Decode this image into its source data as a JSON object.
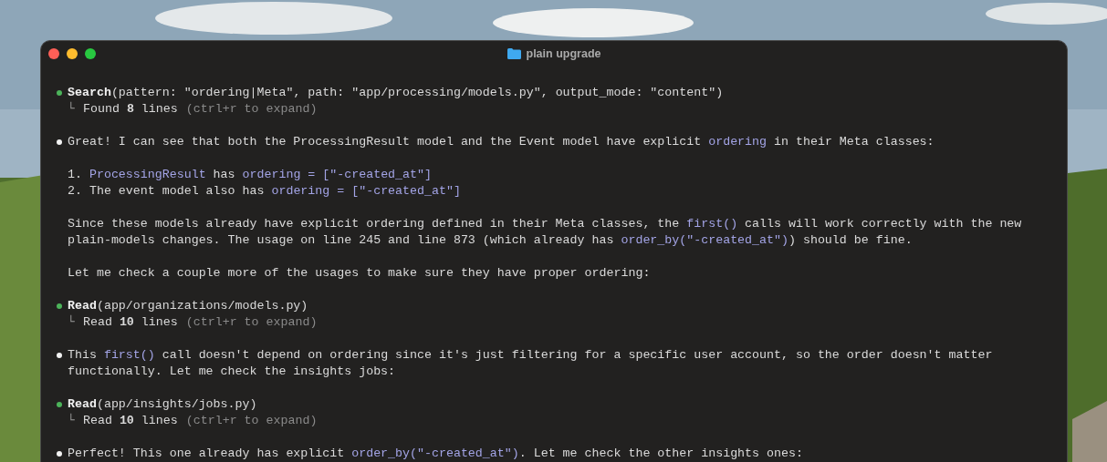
{
  "window": {
    "title": "plain upgrade"
  },
  "transcript": [
    {
      "kind": "tool",
      "name": "Search",
      "args": "(pattern: \"ordering|Meta\", path: \"app/processing/models.py\", output_mode: \"content\")",
      "connector": "└",
      "result": "Found **8** lines",
      "hint": "(ctrl+r to expand)"
    },
    {
      "kind": "message",
      "paragraphs": [
        {
          "kind": "text",
          "segments": [
            {
              "text": "Great! I can see that both the ProcessingResult model and the Event model have explicit ",
              "code": false
            },
            {
              "text": "ordering",
              "code": true
            },
            {
              "text": " in their Meta classes:",
              "code": false
            }
          ]
        },
        {
          "kind": "list",
          "items": [
            {
              "marker": "1.",
              "segments": [
                {
                  "text": "ProcessingResult",
                  "code": true
                },
                {
                  "text": " has ",
                  "code": false
                },
                {
                  "text": "ordering = [\"-created_at\"]",
                  "code": true
                }
              ]
            },
            {
              "marker": "2.",
              "segments": [
                {
                  "text": "The event model also has ",
                  "code": false
                },
                {
                  "text": "ordering = [\"-created_at\"]",
                  "code": true
                }
              ]
            }
          ]
        },
        {
          "kind": "text",
          "segments": [
            {
              "text": "Since these models already have explicit ordering defined in their Meta classes, the ",
              "code": false
            },
            {
              "text": "first()",
              "code": true
            },
            {
              "text": " calls will work correctly with the new plain-models changes. The usage on line 245 and line 873 (which already has ",
              "code": false
            },
            {
              "text": "order_by(\"-created_at\")",
              "code": true
            },
            {
              "text": ") should be fine.",
              "code": false
            }
          ]
        },
        {
          "kind": "text",
          "segments": [
            {
              "text": "Let me check a couple more of the usages to make sure they have proper ordering:",
              "code": false
            }
          ]
        }
      ]
    },
    {
      "kind": "tool",
      "name": "Read",
      "args": "(app/organizations/models.py)",
      "connector": "└",
      "result": "Read **10** lines",
      "hint": "(ctrl+r to expand)"
    },
    {
      "kind": "message",
      "paragraphs": [
        {
          "kind": "text",
          "segments": [
            {
              "text": "This ",
              "code": false
            },
            {
              "text": "first()",
              "code": true
            },
            {
              "text": " call doesn't depend on ordering since it's just filtering for a specific user account, so the order doesn't matter functionally. Let me check the insights jobs:",
              "code": false
            }
          ]
        }
      ]
    },
    {
      "kind": "tool",
      "name": "Read",
      "args": "(app/insights/jobs.py)",
      "connector": "└",
      "result": "Read **10** lines",
      "hint": "(ctrl+r to expand)"
    },
    {
      "kind": "message",
      "paragraphs": [
        {
          "kind": "text",
          "segments": [
            {
              "text": "Perfect! This one already has explicit ",
              "code": false
            },
            {
              "text": "order_by(\"-created_at\")",
              "code": true
            },
            {
              "text": ". Let me check the other insights ones:",
              "code": false
            }
          ]
        }
      ]
    }
  ]
}
